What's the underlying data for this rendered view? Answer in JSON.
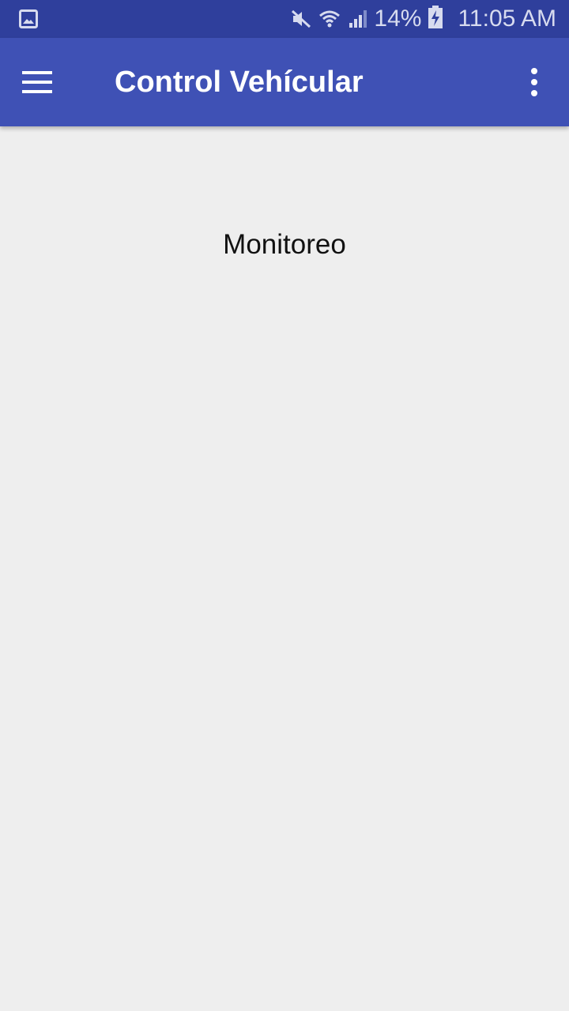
{
  "status_bar": {
    "notification_icon": "gallery-icon",
    "mute_icon": "mute-icon",
    "wifi_icon": "wifi-icon",
    "signal_icon": "cell-signal-icon",
    "battery_percent": "14%",
    "battery_icon": "battery-charging-icon",
    "time": "11:05 AM"
  },
  "app_bar": {
    "menu_icon": "hamburger-menu-icon",
    "title": "Control Vehícular",
    "overflow_icon": "more-vertical-icon"
  },
  "main": {
    "label": "Monitoreo"
  },
  "colors": {
    "status_bar": "#2f3f9c",
    "app_bar": "#3f51b5",
    "background": "#eeeeee",
    "title_text": "#ffffff"
  }
}
